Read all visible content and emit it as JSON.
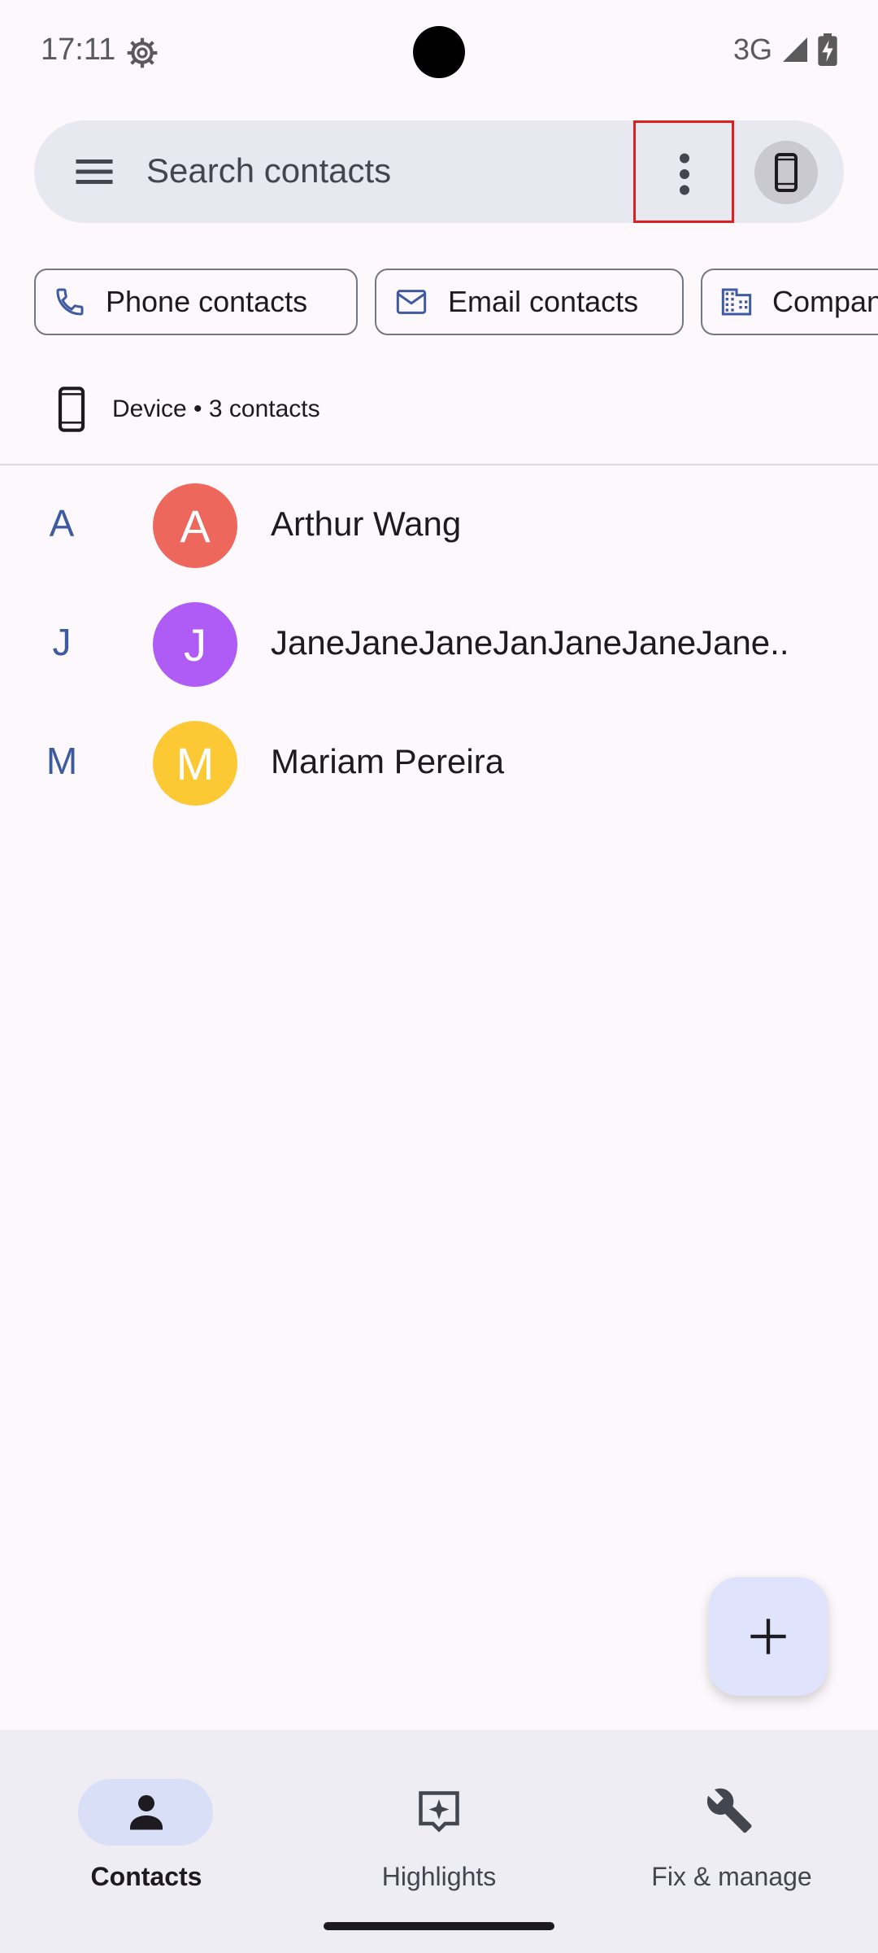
{
  "status_bar": {
    "time": "17:11",
    "network": "3G",
    "icons": [
      "settings-gear-icon",
      "signal-icon",
      "battery-charging-icon"
    ]
  },
  "search": {
    "placeholder": "Search contacts",
    "menu_icon": "hamburger-menu-icon",
    "more_icon": "more-vert-icon",
    "account_icon": "phone-device-icon"
  },
  "filter_chips": [
    {
      "label": "Phone contacts",
      "icon": "phone-icon"
    },
    {
      "label": "Email contacts",
      "icon": "mail-icon"
    },
    {
      "label": "Compan",
      "icon": "business-icon"
    }
  ],
  "account": {
    "label": "Device • 3 contacts",
    "icon": "phone-device-icon"
  },
  "contacts": [
    {
      "section": "A",
      "initial": "A",
      "name": "Arthur Wang",
      "color": "#ee675c"
    },
    {
      "section": "J",
      "initial": "J",
      "name": "JaneJaneJaneJanJaneJaneJane..",
      "color": "#af5cf7"
    },
    {
      "section": "M",
      "initial": "M",
      "name": "Mariam Pereira",
      "color": "#fcc934"
    }
  ],
  "fab": {
    "icon": "plus-icon"
  },
  "bottom_nav": [
    {
      "label": "Contacts",
      "icon": "person-icon",
      "active": true
    },
    {
      "label": "Highlights",
      "icon": "sparkle-icon",
      "active": false
    },
    {
      "label": "Fix & manage",
      "icon": "wrench-icon",
      "active": false
    }
  ],
  "colors": {
    "accent": "#3e5aa0",
    "background": "#fcf8fc",
    "search_bg": "#e8e8f0",
    "fab_bg": "#dfe3fb",
    "nav_bg": "#efedf4",
    "nav_active_pill": "#d9dff6"
  }
}
